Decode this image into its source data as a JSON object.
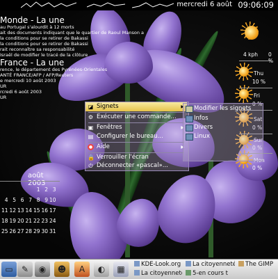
{
  "top_bar": {
    "monitor_labels": [
      "",
      "",
      ""
    ],
    "date": "mercredi 6 août",
    "time": "09:06:09"
  },
  "news": {
    "world": {
      "title": "Monde - La une",
      "lines": [
        "au Portugal s'alourdit à 12 morts",
        "ait des documents indiquant que le quartier de Raoul Manson a",
        "la conditions pour se retirer de Bakassi",
        "la conditions pour se retirer de Bakassi",
        "rait reconnaître sa responsabilité",
        "Israël de modifier le tracé de la clôture"
      ]
    },
    "france": {
      "title": "France - La une",
      "lines": [
        "rence, le département des Pyrénées-Orientales",
        "ANTÉ FRANCE/AFP / AFP/Reuters",
        "e mercredi 10 août 2003",
        "UR",
        "rcredi 6 août 2003",
        "UR"
      ]
    }
  },
  "calendar": {
    "title": "août 2003",
    "rows": [
      [
        "1",
        "2",
        "3"
      ],
      [
        "4",
        "5",
        "6",
        "7",
        "8",
        "9",
        "10"
      ],
      [
        "11",
        "12",
        "13",
        "14",
        "15",
        "16",
        "17"
      ],
      [
        "18",
        "19",
        "20",
        "21",
        "22",
        "23",
        "24"
      ],
      [
        "25",
        "26",
        "27",
        "28",
        "29",
        "30",
        "31"
      ]
    ]
  },
  "weather": {
    "current_wind": "4 kph",
    "current_pct": "0 %",
    "days": [
      {
        "day": "Thu",
        "pct": "10 %"
      },
      {
        "day": "Fri",
        "pct": "0 %"
      },
      {
        "day": "Sat",
        "pct": "0 %"
      },
      {
        "day": "Sun",
        "pct": "0 %"
      },
      {
        "day": "Mon",
        "pct": "0 %"
      }
    ]
  },
  "menu": {
    "items": [
      {
        "label": "Signets",
        "icon": "bookmark-icon",
        "has_submenu": true
      },
      {
        "label": "Exécuter une commande...",
        "icon": "run-icon",
        "has_submenu": false
      },
      {
        "label": "Fenêtres",
        "icon": "windows-icon",
        "has_submenu": true
      },
      {
        "label": "Configurer le bureau...",
        "icon": "configure-icon",
        "has_submenu": false
      },
      {
        "label": "Aide",
        "icon": "help-icon",
        "has_submenu": true
      },
      {
        "label": "Verrouiller l'écran",
        "icon": "lock-icon",
        "has_submenu": false
      },
      {
        "label": "Déconnecter «pascal»...",
        "icon": "logout-icon",
        "has_submenu": false
      }
    ]
  },
  "submenu": {
    "items": [
      {
        "label": "Modifier les signets",
        "icon": "edit-bookmarks-icon"
      },
      {
        "label": "Infos",
        "icon": "folder-icon"
      },
      {
        "label": "Divers",
        "icon": "folder-icon"
      },
      {
        "label": "Linux",
        "icon": "folder-icon"
      }
    ]
  },
  "taskbar": {
    "tasks": [
      {
        "label": "KDE-Look.org"
      },
      {
        "label": "La citoyenneté"
      },
      {
        "label": "The GIMP"
      },
      {
        "label": "La citoyenneté"
      },
      {
        "label": "5-en cours t"
      }
    ]
  },
  "colors": {
    "menu_highlight": "#e6c24a",
    "iris_purple": "#9273cf",
    "taskbar_bg": "#d8d8d8"
  }
}
